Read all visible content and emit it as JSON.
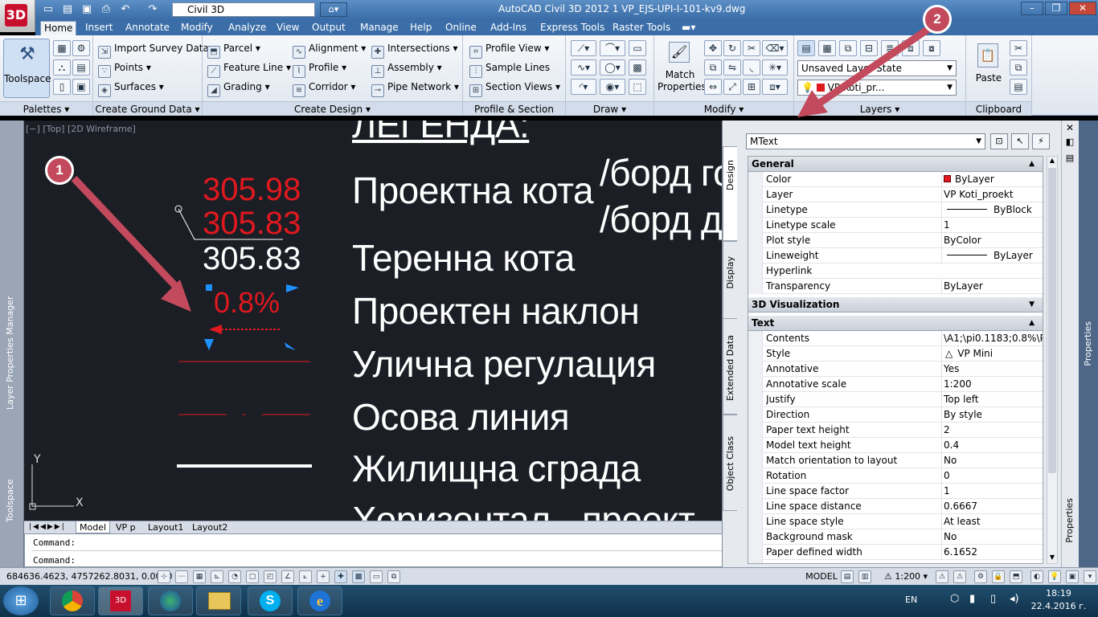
{
  "title_bar": {
    "workspace": "Civil 3D",
    "title": "AutoCAD Civil 3D 2012    1 VP_EJS-UPI-I-101-kv9.dwg",
    "app_logo": "3D"
  },
  "tabs": [
    "Home",
    "Insert",
    "Annotate",
    "Modify",
    "Analyze",
    "View",
    "Output",
    "Manage",
    "Help",
    "Online",
    "Add-Ins",
    "Express Tools",
    "Raster Tools"
  ],
  "ribbon": {
    "palettes": {
      "toolspace": "Toolspace",
      "label": "Palettes"
    },
    "ground": {
      "items": [
        "Import Survey Data",
        "Points",
        "Surfaces"
      ],
      "label": "Create Ground Data"
    },
    "design": {
      "col1": [
        "Parcel",
        "Feature Line",
        "Grading"
      ],
      "col2": [
        "Alignment",
        "Profile",
        "Corridor"
      ],
      "col3": [
        "Intersections",
        "Assembly",
        "Pipe Network"
      ],
      "label": "Create Design"
    },
    "profile": {
      "items": [
        "Profile View",
        "Sample Lines",
        "Section Views"
      ],
      "label": "Profile & Section Views"
    },
    "draw": {
      "label": "Draw"
    },
    "modify": {
      "match": "Match Properties",
      "label": "Modify"
    },
    "layers": {
      "state": "Unsaved Layer State",
      "layer": "VP Koti_pr...",
      "label": "Layers"
    },
    "clipboard": {
      "paste": "Paste",
      "label": "Clipboard"
    }
  },
  "viewport": {
    "label": "[−] [Top] [2D Wireframe]",
    "heading": "ЛЕГЕНДА:",
    "legend": [
      "Проектна кота",
      "Теренна кота",
      "Проектен наклон",
      "Улична регулация",
      "Осова линия",
      "Жилищна сграда",
      "Хоризонтал - проект"
    ],
    "side_text": [
      "/борд го",
      "/борд до"
    ],
    "values": {
      "red1": "305.98",
      "red2": "305.83",
      "white": "305.83",
      "slope": "0.8%"
    },
    "ucs": {
      "x": "X",
      "y": "Y"
    }
  },
  "left_strip": {
    "top": "Layer Properties Manager",
    "bottom": "Toolspace"
  },
  "layout_tabs": [
    "Model",
    "VP p",
    "Layout1",
    "Layout2"
  ],
  "command": {
    "line1": "Command:",
    "line2": "Command:"
  },
  "properties": {
    "object": "MText",
    "side_tabs": [
      "Design",
      "Display",
      "Extended Data",
      "Object Class"
    ],
    "palette_title": "Properties",
    "general": {
      "title": "General",
      "rows": [
        {
          "k": "Color",
          "v": "ByLayer"
        },
        {
          "k": "Layer",
          "v": "VP Koti_proekt"
        },
        {
          "k": "Linetype",
          "v": "ByBlock"
        },
        {
          "k": "Linetype scale",
          "v": "1"
        },
        {
          "k": "Plot style",
          "v": "ByColor"
        },
        {
          "k": "Lineweight",
          "v": "ByLayer"
        },
        {
          "k": "Hyperlink",
          "v": ""
        },
        {
          "k": "Transparency",
          "v": "ByLayer"
        }
      ]
    },
    "viz": {
      "title": "3D Visualization"
    },
    "text": {
      "title": "Text",
      "rows": [
        {
          "k": "Contents",
          "v": "\\A1;\\pi0.1183;0.8%\\P\\..."
        },
        {
          "k": "Style",
          "v": "VP Mini"
        },
        {
          "k": "Annotative",
          "v": "Yes"
        },
        {
          "k": "Annotative scale",
          "v": "1:200"
        },
        {
          "k": "Justify",
          "v": "Top left"
        },
        {
          "k": "Direction",
          "v": "By style"
        },
        {
          "k": "Paper text height",
          "v": "2"
        },
        {
          "k": "Model text height",
          "v": "0.4"
        },
        {
          "k": "Match orientation to layout",
          "v": "No"
        },
        {
          "k": "Rotation",
          "v": "0"
        },
        {
          "k": "Line space factor",
          "v": "1"
        },
        {
          "k": "Line space distance",
          "v": "0.6667"
        },
        {
          "k": "Line space style",
          "v": "At least"
        },
        {
          "k": "Background mask",
          "v": "No"
        },
        {
          "k": "Paper defined width",
          "v": "6.1652"
        }
      ]
    }
  },
  "statusbar": {
    "coords": "684636.4623, 4757262.8031, 0.0000",
    "model": "MODEL",
    "scale": "1:200"
  },
  "taskbar": {
    "lang": "EN",
    "time": "18:19",
    "date": "22.4.2016 г."
  },
  "callouts": [
    "1",
    "2"
  ],
  "colors": {
    "red": "#e0191f",
    "callout": "#c24a5c",
    "canvas": "#1b1e25",
    "blue": "#1e90ff"
  }
}
